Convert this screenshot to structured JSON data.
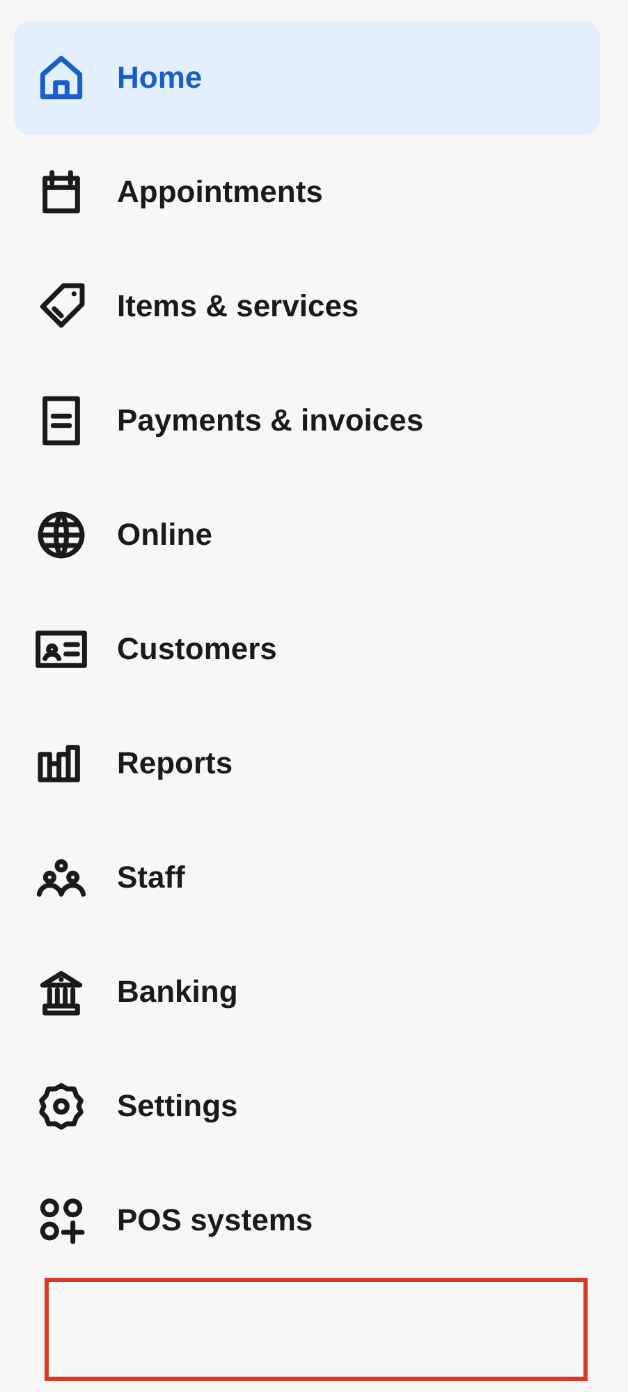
{
  "nav": {
    "items": [
      {
        "label": "Home",
        "selected": true
      },
      {
        "label": "Appointments",
        "selected": false
      },
      {
        "label": "Items & services",
        "selected": false
      },
      {
        "label": "Payments & invoices",
        "selected": false
      },
      {
        "label": "Online",
        "selected": false
      },
      {
        "label": "Customers",
        "selected": false
      },
      {
        "label": "Reports",
        "selected": false
      },
      {
        "label": "Staff",
        "selected": false
      },
      {
        "label": "Banking",
        "selected": false
      },
      {
        "label": "Settings",
        "selected": false
      },
      {
        "label": "POS systems",
        "selected": false
      }
    ]
  }
}
